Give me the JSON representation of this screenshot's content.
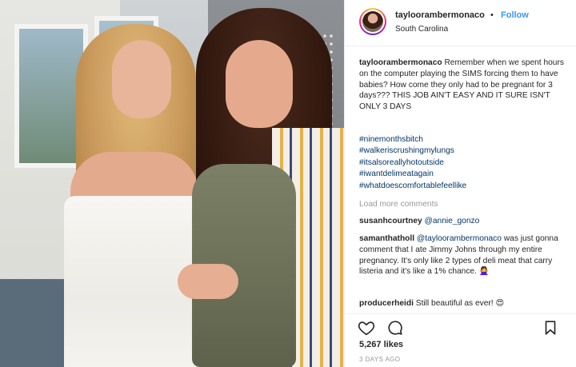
{
  "post": {
    "username": "tayloorambermonaco",
    "follow_separator": "•",
    "follow_label": "Follow",
    "location": "South Carolina"
  },
  "caption": {
    "username": "tayloorambermonaco",
    "text": "Remember when we spent hours on the computer playing the SIMS forcing them to have babies? How come they only had to be pregnant for 3 days??? THIS JOB AIN'T EASY AND IT SURE ISN'T ONLY 3 DAYS",
    "hashtags": [
      "#ninemonthsbitch",
      "#walkeriscrushingmylungs",
      "#itsalsoreallyhotoutside",
      "#iwantdelimeatagain",
      "#whatdoescomfortablefeellike"
    ]
  },
  "load_more_label": "Load more comments",
  "comments": [
    {
      "username": "susanhcourtney",
      "mention": "@annie_gonzo",
      "text": ""
    },
    {
      "username": "samanthatholl",
      "mention": "@tayloorambermonaco",
      "text": "was just gonna comment that I ate Jimmy Johns through my entire pregnancy. It's only like 2 types of deli meat that carry listeria and it's like a 1% chance. 🙅‍♀️"
    },
    {
      "username": "producerheidi",
      "mention": "",
      "text": "Still beautiful as ever! 😍"
    }
  ],
  "actions": {
    "heart_icon": "heart-icon",
    "comment_icon": "comment-icon",
    "bookmark_icon": "bookmark-icon"
  },
  "likes": "5,267 likes",
  "timestamp": "3 DAYS AGO",
  "colors": {
    "link": "#003569",
    "follow": "#3897f0",
    "muted": "#999999",
    "text": "#262626"
  }
}
